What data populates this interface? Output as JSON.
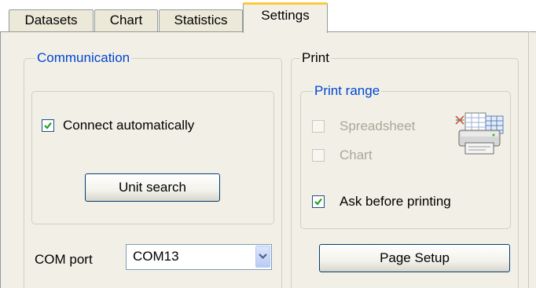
{
  "tabs": [
    {
      "label": "Datasets",
      "active": false
    },
    {
      "label": "Chart",
      "active": false
    },
    {
      "label": "Statistics",
      "active": false
    },
    {
      "label": "Settings",
      "active": true
    }
  ],
  "communication": {
    "title": "Communication",
    "connect_auto": {
      "label": "Connect automatically",
      "checked": true
    },
    "unit_search_label": "Unit search",
    "com_port": {
      "label": "COM port",
      "value": "COM13"
    }
  },
  "print": {
    "title": "Print",
    "range": {
      "title": "Print range",
      "spreadsheet": {
        "label": "Spreadsheet",
        "checked": false,
        "enabled": false
      },
      "chart": {
        "label": "Chart",
        "checked": false,
        "enabled": false
      }
    },
    "ask_before": {
      "label": "Ask before printing",
      "checked": true
    },
    "page_setup_label": "Page Setup",
    "icon": "printer-spreadsheet-icon"
  },
  "colors": {
    "accent_blue": "#0046d5",
    "tab_highlight": "#ffc83c",
    "panel_bg": "#f2f0e6",
    "check_green": "#21a121"
  }
}
